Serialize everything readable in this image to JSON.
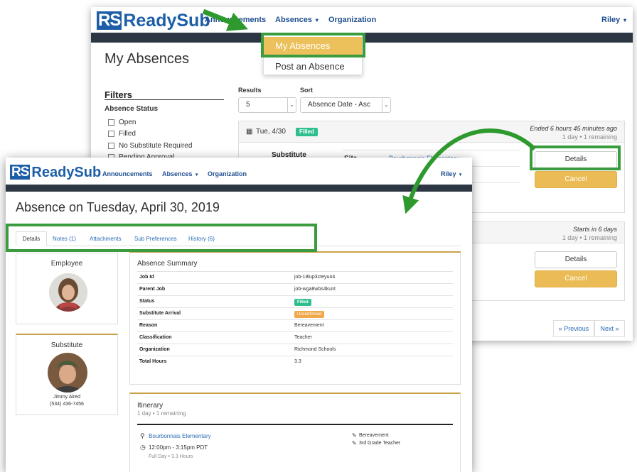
{
  "brand": {
    "logo_mark": "RS",
    "logo_text": "ReadySub",
    "primary_color": "#1d5ea8",
    "highlight_color": "#3b9b3f",
    "accent_color": "#ebbb55"
  },
  "back_window": {
    "nav": {
      "announcements": "Announcements",
      "absences": "Absences",
      "organization": "Organization",
      "user": "Riley"
    },
    "dropdown": {
      "my_absences": "My Absences",
      "post_absence": "Post an Absence"
    },
    "page_title": "My Absences",
    "filters": {
      "title": "Filters",
      "status_label": "Absence Status",
      "options": [
        "Open",
        "Filled",
        "No Substitute Required",
        "Pending Approval"
      ]
    },
    "results": {
      "label": "Results",
      "value": "5"
    },
    "sort": {
      "label": "Sort",
      "value": "Absence Date - Asc"
    },
    "absence1": {
      "date": "Tue, 4/30",
      "status": "Filled",
      "ended": "Ended 6 hours 45 minutes ago",
      "meta": "1 day • 1 remaining",
      "substitute_label": "Substitute",
      "site_label": "Site",
      "site_value": "Bourbonnais Elementary",
      "details": "Details",
      "cancel": "Cancel"
    },
    "absence2": {
      "starts": "Starts in 6 days",
      "meta": "1 day • 1 remaining",
      "details": "Details",
      "cancel": "Cancel"
    },
    "pager": {
      "prev": "« Previous",
      "next": "Next »"
    }
  },
  "front_window": {
    "nav": {
      "announcements": "Announcements",
      "absences": "Absences",
      "organization": "Organization",
      "user": "Riley"
    },
    "page_title": "Absence on Tuesday, April 30, 2019",
    "tabs": [
      "Details",
      "Notes (1)",
      "Attachments",
      "Sub Preferences",
      "History (6)"
    ],
    "employee": {
      "heading": "Employee"
    },
    "substitute": {
      "heading": "Substitute",
      "name": "Jimmy Alred",
      "phone": "(534) 436-7456"
    },
    "summary": {
      "heading": "Absence Summary",
      "job_id_label": "Job Id",
      "job_id": "job-18lup3cteyu44",
      "parent_job_label": "Parent Job",
      "parent_job": "job-wga8wbs4kunt",
      "status_label": "Status",
      "status": "Filled",
      "arrival_label": "Substitute Arrival",
      "arrival": "Unconfirmed",
      "reason_label": "Reason",
      "reason": "Bereavement",
      "classification_label": "Classification",
      "classification": "Teacher",
      "organization_label": "Organization",
      "organization": "Richmond Schools",
      "hours_label": "Total Hours",
      "hours": "3.3"
    },
    "itinerary": {
      "heading": "Itinerary",
      "meta": "1 day • 1 remaining",
      "site": "Bourbonnais Elementary",
      "time": "12:00pm - 3:15pm PDT",
      "sub_time": "Full Day • 3.3 Hours",
      "reason": "Bereavement",
      "position": "3rd Grade Teacher"
    }
  }
}
